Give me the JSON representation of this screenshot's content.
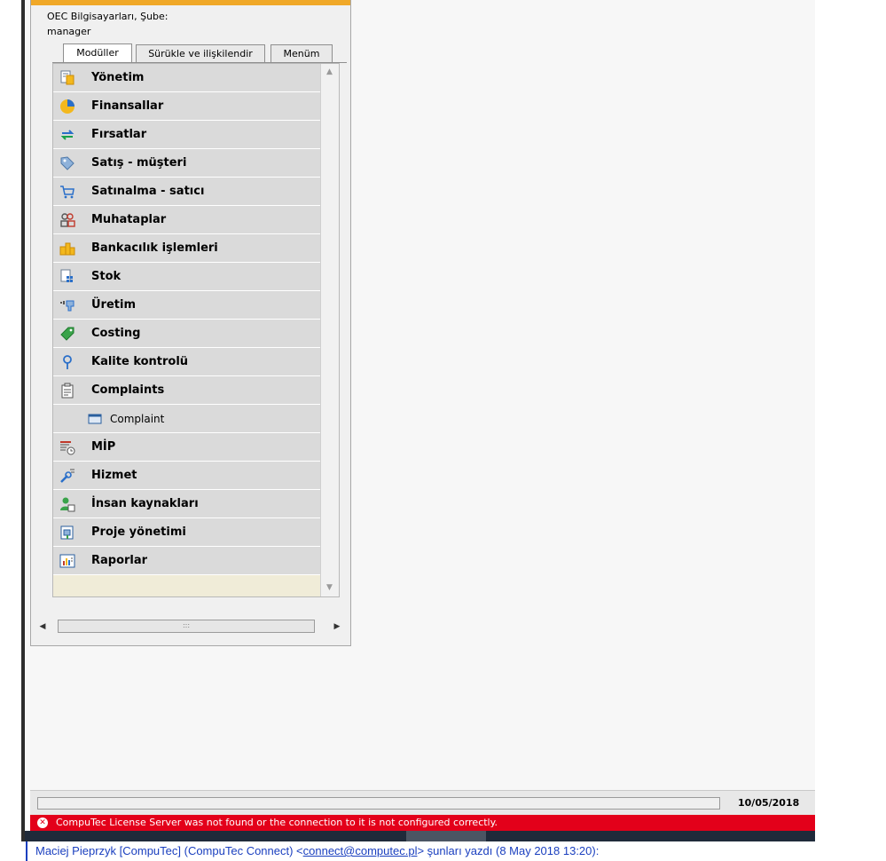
{
  "window": {
    "company": "OEC Bilgisayarları, Şube:",
    "user": "manager"
  },
  "tabs": [
    {
      "label": "Modüller",
      "active": true
    },
    {
      "label": "Sürükle ve ilişkilendir",
      "active": false
    },
    {
      "label": "Menüm",
      "active": false
    }
  ],
  "modules": [
    {
      "label": "Yönetim",
      "icon": "admin-icon"
    },
    {
      "label": "Finansallar",
      "icon": "pie-chart-icon"
    },
    {
      "label": "Fırsatlar",
      "icon": "opportunity-arrows-icon"
    },
    {
      "label": "Satış - müşteri",
      "icon": "sales-tag-icon"
    },
    {
      "label": "Satınalma - satıcı",
      "icon": "cart-icon"
    },
    {
      "label": "Muhataplar",
      "icon": "partners-icon"
    },
    {
      "label": "Bankacılık işlemleri",
      "icon": "banking-coins-icon"
    },
    {
      "label": "Stok",
      "icon": "inventory-icon"
    },
    {
      "label": "Üretim",
      "icon": "production-icon"
    },
    {
      "label": "Costing",
      "icon": "costing-tag-icon"
    },
    {
      "label": "Kalite kontrolü",
      "icon": "quality-pin-icon"
    },
    {
      "label": "Complaints",
      "icon": "clipboard-icon"
    },
    {
      "label": "Complaint",
      "icon": "form-window-icon",
      "sub": true
    },
    {
      "label": "MİP",
      "icon": "mrp-calendar-icon"
    },
    {
      "label": "Hizmet",
      "icon": "service-wrench-icon"
    },
    {
      "label": "İnsan kaynakları",
      "icon": "hr-person-icon"
    },
    {
      "label": "Proje yönetimi",
      "icon": "project-icon"
    },
    {
      "label": "Raporlar",
      "icon": "reports-icon"
    }
  ],
  "hscroll": {
    "thumb_grip": ":::"
  },
  "status": {
    "date": "10/05/2018"
  },
  "error": {
    "message": "CompuTec License Server was not found or the connection to it is not configured correctly."
  },
  "mail": {
    "prefix": "Maciej Pieprzyk [CompuTec] (CompuTec Connect) <",
    "email": "connect@computec.pl",
    "suffix": "> şunları yazdı (8 May 2018 13:20):"
  },
  "colors": {
    "accent": "#f0a828",
    "error": "#e3001a",
    "link": "#1a3fbf"
  }
}
